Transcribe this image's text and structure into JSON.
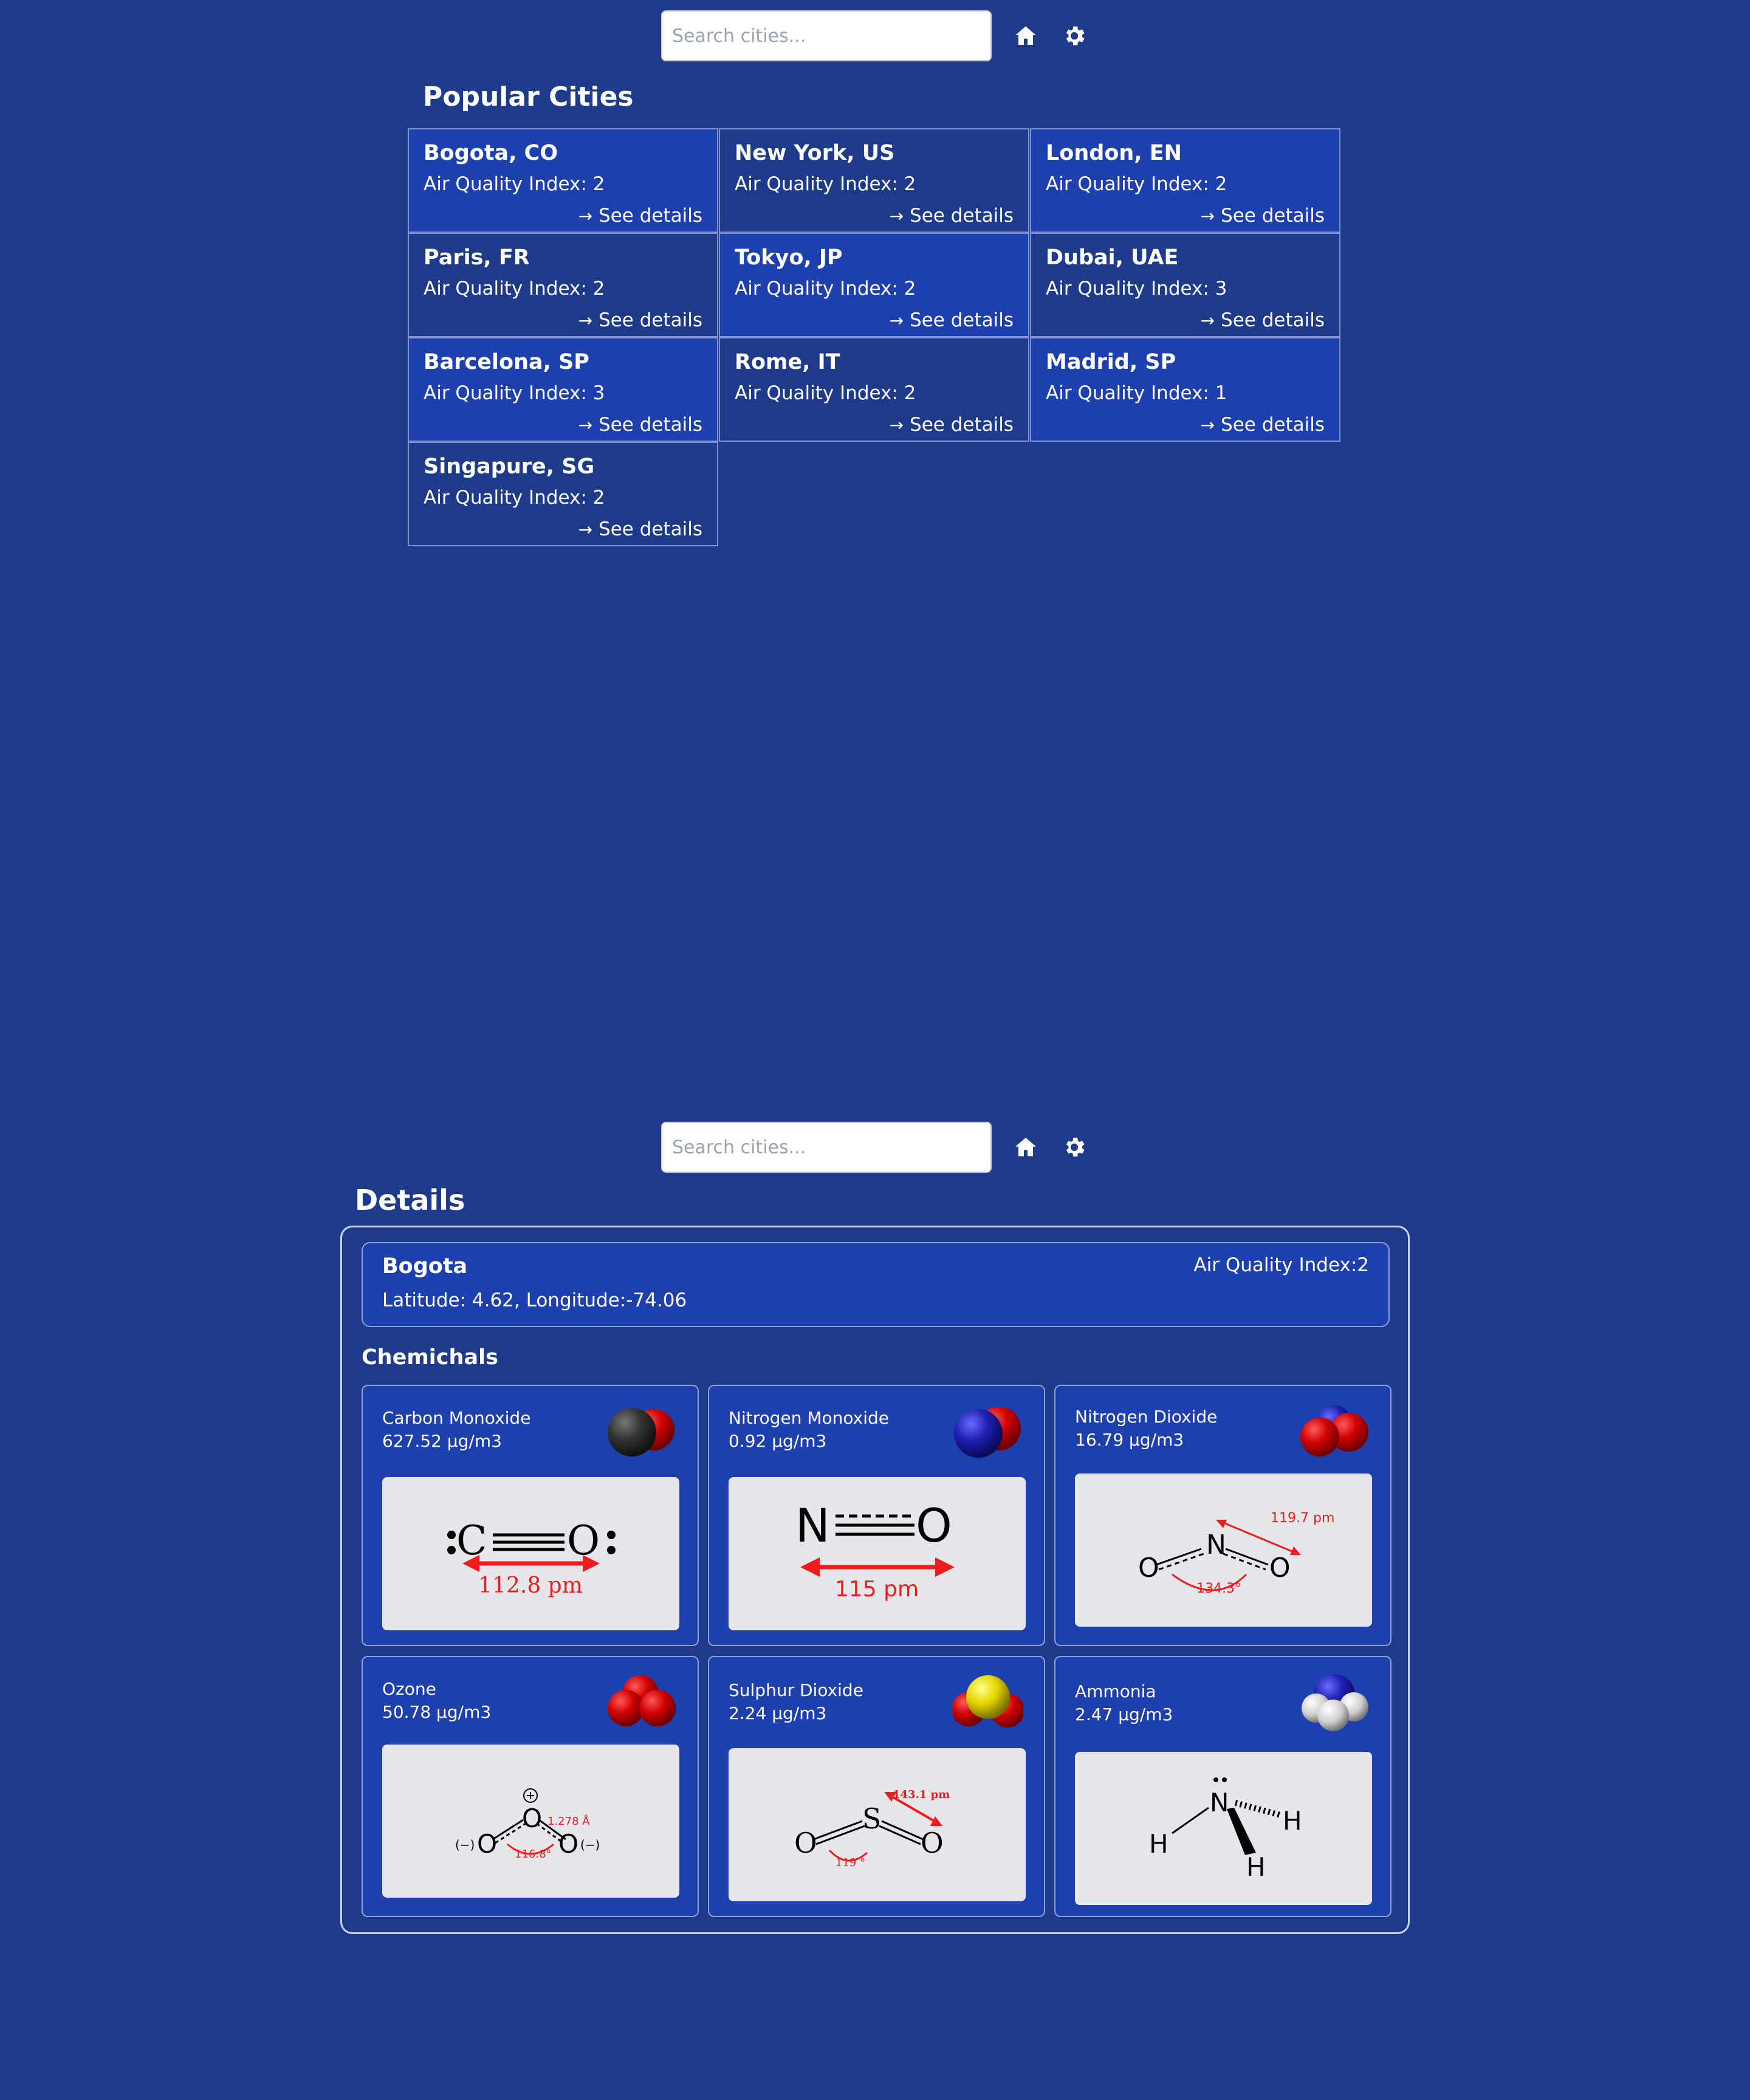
{
  "search": {
    "placeholder": "Search cities..."
  },
  "icons": {
    "home": "home-icon",
    "settings": "gear-icon"
  },
  "popular": {
    "title": "Popular Cities",
    "see_details_label": "See details",
    "cities": [
      {
        "name": "Bogota, CO",
        "aqi": "Air Quality Index: 2"
      },
      {
        "name": "New York, US",
        "aqi": "Air Quality Index: 2"
      },
      {
        "name": "London, EN",
        "aqi": "Air Quality Index: 2"
      },
      {
        "name": "Paris, FR",
        "aqi": "Air Quality Index: 2"
      },
      {
        "name": "Tokyo, JP",
        "aqi": "Air Quality Index: 2"
      },
      {
        "name": "Dubai, UAE",
        "aqi": "Air Quality Index: 3"
      },
      {
        "name": "Barcelona, SP",
        "aqi": "Air Quality Index: 3"
      },
      {
        "name": "Rome, IT",
        "aqi": "Air Quality Index: 2"
      },
      {
        "name": "Madrid, SP",
        "aqi": "Air Quality Index: 1"
      },
      {
        "name": "Singapure, SG",
        "aqi": "Air Quality Index: 2"
      }
    ]
  },
  "details": {
    "title": "Details",
    "city": "Bogota",
    "coords": "Latitude: 4.62, Longitude:-74.06",
    "aqi": "Air Quality Index:2",
    "chemicals_title": "Chemichals",
    "chemicals": [
      {
        "name": "Carbon Monoxide",
        "value": "627.52 μg/m3",
        "diagram_label": "112.8 pm"
      },
      {
        "name": "Nitrogen Monoxide",
        "value": "0.92 μg/m3",
        "diagram_label": "115 pm"
      },
      {
        "name": "Nitrogen Dioxide",
        "value": "16.79 μg/m3",
        "diagram_label": "119.7 pm",
        "diagram_angle": "134.3°"
      },
      {
        "name": "Ozone",
        "value": "50.78 μg/m3",
        "diagram_label": "1.278 Å",
        "diagram_angle": "116.8°"
      },
      {
        "name": "Sulphur Dioxide",
        "value": "2.24 μg/m3",
        "diagram_label": "143.1 pm",
        "diagram_angle": "119 °"
      },
      {
        "name": "Ammonia",
        "value": "2.47 μg/m3"
      }
    ]
  },
  "colors": {
    "background": "#1e3a8a",
    "card_highlight": "#1e40af",
    "diagram_bg": "#e5e7eb",
    "measure_red": "#ee1c1c"
  }
}
